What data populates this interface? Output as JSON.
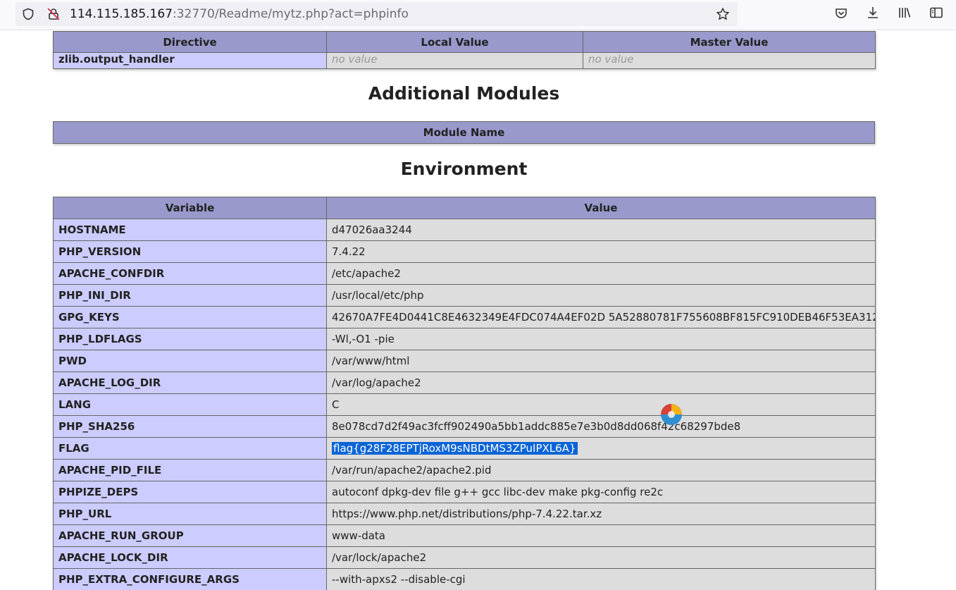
{
  "browser": {
    "url_host": "114.115.185.167",
    "url_rest": ":32770/Readme/mytz.php?act=phpinfo"
  },
  "directive_table": {
    "headers": [
      "Directive",
      "Local Value",
      "Master Value"
    ],
    "rows": [
      {
        "name": "zlib.output_handler",
        "local": "no value",
        "master": "no value"
      }
    ]
  },
  "modules": {
    "title": "Additional Modules",
    "header": "Module Name"
  },
  "environment": {
    "title": "Environment",
    "headers": [
      "Variable",
      "Value"
    ],
    "rows": [
      {
        "name": "HOSTNAME",
        "value": "d47026aa3244"
      },
      {
        "name": "PHP_VERSION",
        "value": "7.4.22"
      },
      {
        "name": "APACHE_CONFDIR",
        "value": "/etc/apache2"
      },
      {
        "name": "PHP_INI_DIR",
        "value": "/usr/local/etc/php"
      },
      {
        "name": "GPG_KEYS",
        "value": "42670A7FE4D0441C8E4632349E4FDC074A4EF02D 5A52880781F755608BF815FC910DEB46F53EA312"
      },
      {
        "name": "PHP_LDFLAGS",
        "value": "-Wl,-O1 -pie"
      },
      {
        "name": "PWD",
        "value": "/var/www/html"
      },
      {
        "name": "APACHE_LOG_DIR",
        "value": "/var/log/apache2"
      },
      {
        "name": "LANG",
        "value": "C"
      },
      {
        "name": "PHP_SHA256",
        "value": "8e078cd7d2f49ac3fcff902490a5bb1addc885e7e3b0d8dd068f42c68297bde8"
      },
      {
        "name": "FLAG",
        "value": "flag{g28F28EPTjRoxM9sNBDtMS3ZPuIPXL6A}"
      },
      {
        "name": "APACHE_PID_FILE",
        "value": "/var/run/apache2/apache2.pid"
      },
      {
        "name": "PHPIZE_DEPS",
        "value": "autoconf dpkg-dev file g++ gcc libc-dev make pkg-config re2c"
      },
      {
        "name": "PHP_URL",
        "value": "https://www.php.net/distributions/php-7.4.22.tar.xz"
      },
      {
        "name": "APACHE_RUN_GROUP",
        "value": "www-data"
      },
      {
        "name": "APACHE_LOCK_DIR",
        "value": "/var/lock/apache2"
      },
      {
        "name": "PHP_EXTRA_CONFIGURE_ARGS",
        "value": "--with-apxs2 --disable-cgi"
      }
    ]
  }
}
